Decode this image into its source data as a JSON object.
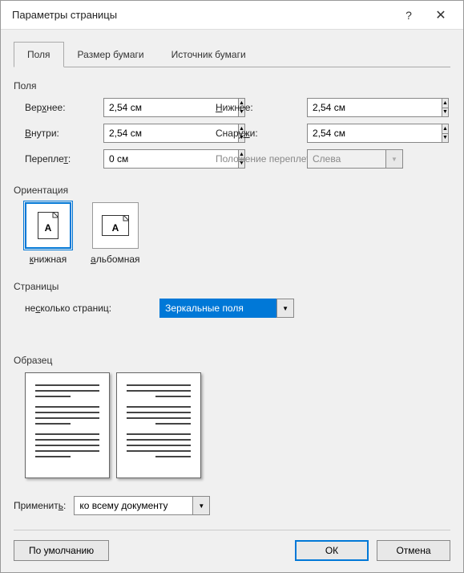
{
  "title": "Параметры страницы",
  "tabs": {
    "t0": "Поля",
    "t1": "Размер бумаги",
    "t2": "Источник бумаги"
  },
  "groups": {
    "margins": "Поля",
    "orientation": "Ориентация",
    "pages": "Страницы",
    "preview": "Образец"
  },
  "margins": {
    "top_label": "Верхнее:",
    "top_val": "2,54 см",
    "bottom_label": "Нижнее:",
    "bottom_val": "2,54 см",
    "inside_label": "Внутри:",
    "inside_val": "2,54 см",
    "outside_label": "Снаружи:",
    "outside_val": "2,54 см",
    "gutter_label": "Переплет:",
    "gutter_val": "0 см",
    "gutterpos_label": "Положение переплета:",
    "gutterpos_val": "Слева"
  },
  "orientation": {
    "portrait": "книжная",
    "landscape": "альбомная"
  },
  "pages": {
    "label": "несколько страниц:",
    "value": "Зеркальные поля"
  },
  "apply": {
    "label": "Применить:",
    "value": "ко всему документу"
  },
  "buttons": {
    "default": "По умолчанию",
    "ok": "ОК",
    "cancel": "Отмена"
  }
}
